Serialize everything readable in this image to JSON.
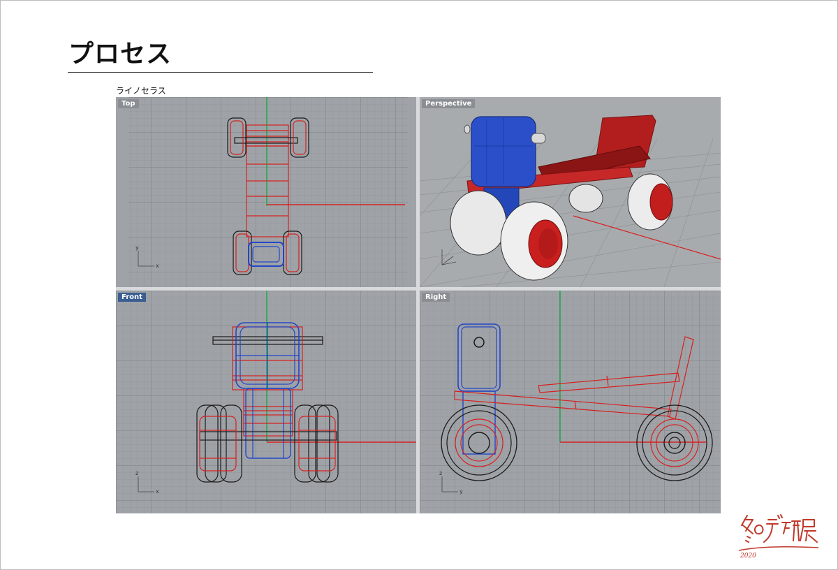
{
  "page": {
    "title": "プロセス",
    "subtitle": "ライノセラス"
  },
  "viewports": [
    {
      "id": "top",
      "label": "Top",
      "active": false
    },
    {
      "id": "perspective",
      "label": "Perspective",
      "active": false
    },
    {
      "id": "front",
      "label": "Front",
      "active": true
    },
    {
      "id": "right",
      "label": "Right",
      "active": false
    }
  ],
  "axes": {
    "top": [
      "y",
      "x"
    ],
    "front": [
      "z",
      "x"
    ],
    "right": [
      "z",
      "y"
    ]
  },
  "logo": {
    "text": "冬のデ研展",
    "year": "2020"
  },
  "colors": {
    "viewport_bg": "#9fa3a7",
    "grid_minor": "#8e9296",
    "grid_major": "#7b8085",
    "wire_red": "#d62020",
    "wire_blue": "#2346c8",
    "wire_black": "#1a1a1a",
    "axis_green": "#1fa84a",
    "label_active": "#3a5e92",
    "logo_red": "#c0392b"
  }
}
